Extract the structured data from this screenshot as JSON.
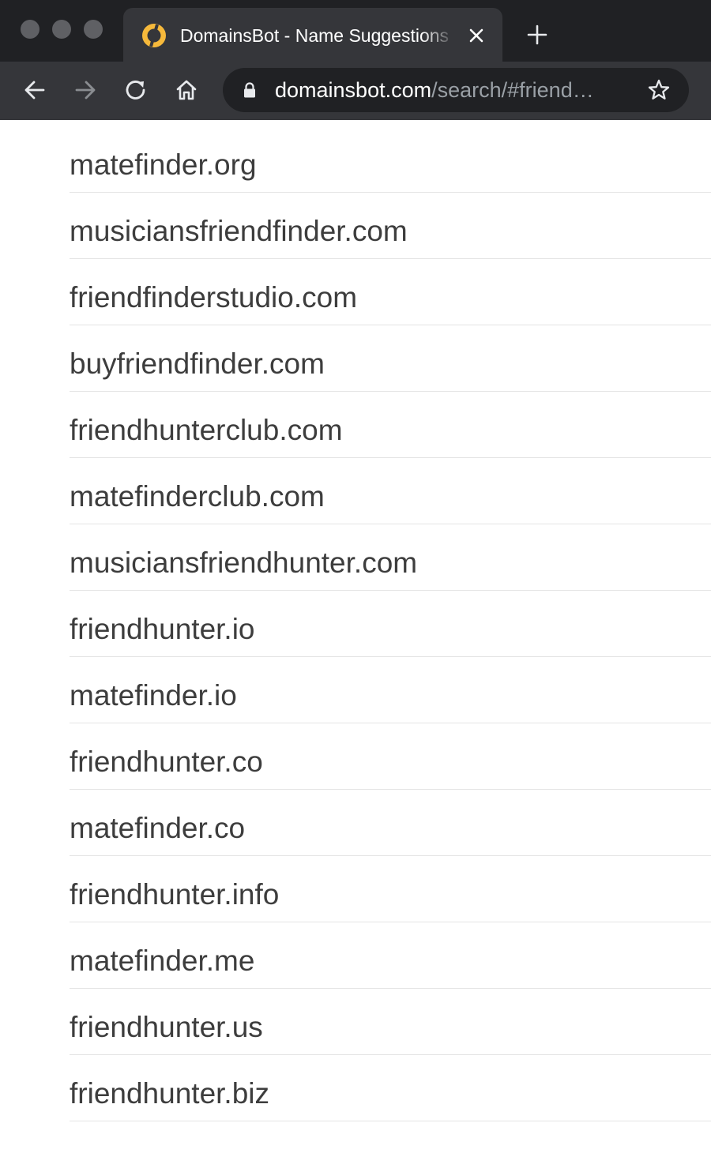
{
  "browser": {
    "tab": {
      "title": "DomainsBot - Name Suggestions",
      "favicon": "domainsbot-logo-icon",
      "favicon_color": "#f6b93b"
    },
    "address_bar": {
      "host": "domainsbot.com",
      "path": "/search/#friend…"
    },
    "icons": {
      "back": "back-arrow-icon",
      "forward": "forward-arrow-icon",
      "reload": "reload-icon",
      "home": "home-icon",
      "lock": "lock-icon",
      "bookmark": "star-icon",
      "new_tab": "plus-icon",
      "close_tab": "close-icon"
    },
    "colors": {
      "tabstrip": "#202124",
      "toolbar": "#35363a",
      "omnibox": "#202124"
    }
  },
  "results": {
    "domains": [
      "matefinder.org",
      "musiciansfriendfinder.com",
      "friendfinderstudio.com",
      "buyfriendfinder.com",
      "friendhunterclub.com",
      "matefinderclub.com",
      "musiciansfriendhunter.com",
      "friendhunter.io",
      "matefinder.io",
      "friendhunter.co",
      "matefinder.co",
      "friendhunter.info",
      "matefinder.me",
      "friendhunter.us",
      "friendhunter.biz"
    ]
  }
}
